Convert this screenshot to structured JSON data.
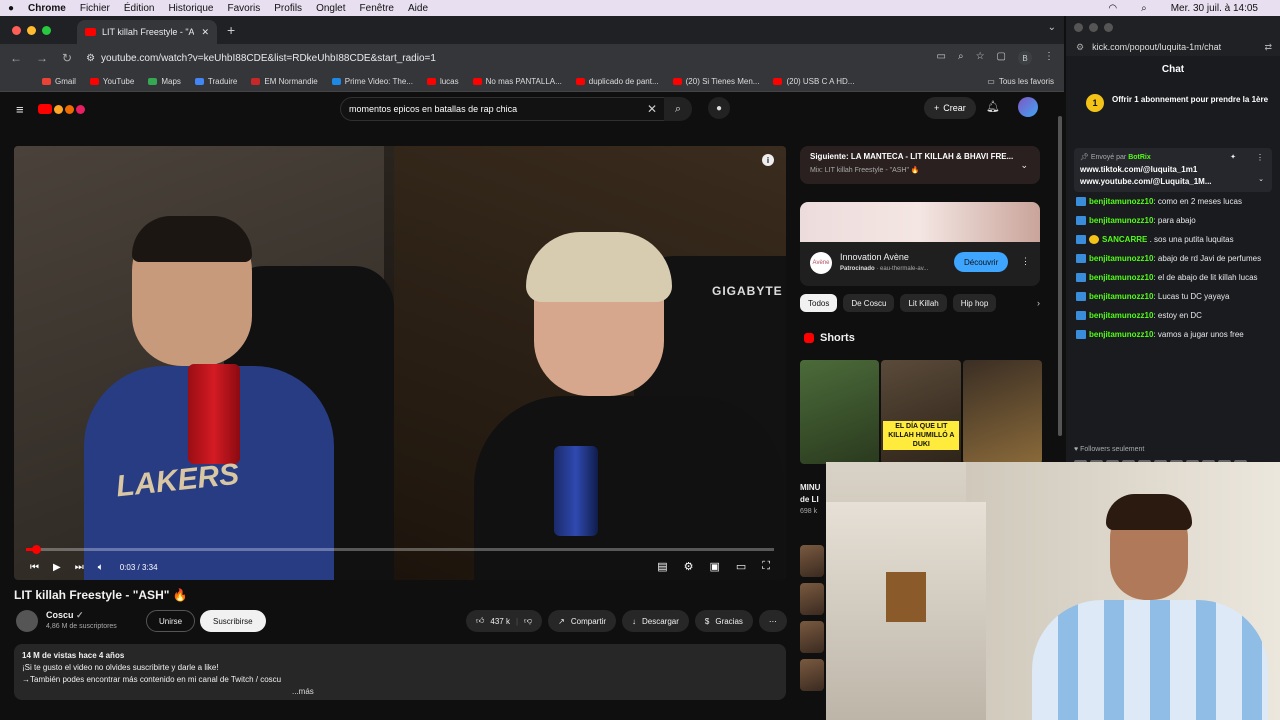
{
  "menubar": {
    "app": "Chrome",
    "items": [
      "Fichier",
      "Édition",
      "Historique",
      "Favoris",
      "Profils",
      "Onglet",
      "Fenêtre",
      "Aide"
    ],
    "clock": "Mer. 30 juil. à 14:05"
  },
  "browser": {
    "tab_title": "LIT killah Freestyle - \"ASH\"",
    "url": "youtube.com/watch?v=keUhbI88CDE&list=RDkeUhbI88CDE&start_radio=1",
    "profile_letter": "B",
    "bookmarks": [
      "Gmail",
      "YouTube",
      "Maps",
      "Traduire",
      "EM Normandie",
      "Prime Video: The...",
      "lucas",
      "No mas PANTALLA...",
      "duplicado de pant...",
      "(20) Si Tienes Men...",
      "(20) USB C A HD..."
    ],
    "bookmarks_all": "Tous les favoris"
  },
  "youtube": {
    "search_value": "momentos epicos en batallas de rap chica",
    "create_label": "Crear",
    "player": {
      "time": "0:03 / 3:34",
      "progress_fraction": 0.014,
      "gigabyte": "GIGABYTE",
      "lakers": "LAKERS"
    },
    "video_title": "LIT killah Freestyle - \"ASH\" 🔥",
    "channel": "Coscu",
    "subscribers": "4,86 M de suscriptores",
    "join_label": "Unirse",
    "subscribe_label": "Suscribirse",
    "likes": "437 k",
    "share_label": "Compartir",
    "download_label": "Descargar",
    "thanks_label": "Gracias",
    "description": {
      "stats": "14 M de vistas  hace 4 años",
      "line1": "¡Si te gusto el video no olvides suscribirte y darle a like!",
      "line2": "→También podes encontrar más contenido en mi canal de Twitch  / coscu",
      "more": "...más"
    },
    "next_up": {
      "title": "Siguiente: LA MANTECA - LIT KILLAH & BHAVI FRE...",
      "sub": "Mix: LIT killah Freestyle - \"ASH\" 🔥"
    },
    "ad": {
      "title": "Innovation Avène",
      "sponsored": "Patrocinado",
      "domain": "· eau-thermale-av...",
      "button": "Découvrir"
    },
    "chips": [
      "Todos",
      "De Coscu",
      "Lit Killah",
      "Hip hop"
    ],
    "shorts_heading": "Shorts",
    "short_caption": "EL DÍA QUE LIT KILLAH HUMILLÓ A DUKI",
    "rest_title": "MINU",
    "rest_title2": "de LI",
    "rest_views": "698 k"
  },
  "kick": {
    "url": "kick.com/popout/luquita-1m/chat",
    "heading": "Chat",
    "gift_text": "Offrir 1 abonnement pour prendre la 1ère",
    "pinned_by": "Envoyé par",
    "pinned_user": "BotRix",
    "pinned_line1": "www.tiktok.com/@luquita_1m1",
    "pinned_line2": "www.youtube.com/@Luquita_1M...",
    "messages": [
      {
        "user": "benjitamunozz10",
        "text": "como en 2 meses lucas"
      },
      {
        "user": "benjitamunozz10",
        "text": "para abajo"
      },
      {
        "user": "SANCARRE",
        "text": ". sos una putita luquitas"
      },
      {
        "user": "benjitamunozz10",
        "text": "abajo de rd Javi de perfumes"
      },
      {
        "user": "benjitamunozz10",
        "text": "el de abajo de lit killah lucas"
      },
      {
        "user": "benjitamunozz10",
        "text": "Lucas tu DC yayaya"
      },
      {
        "user": "benjitamunozz10",
        "text": "estoy en DC"
      },
      {
        "user": "benjitamunozz10",
        "text": "vamos a jugar unos free"
      }
    ],
    "followers_label": "Followers seulement"
  },
  "colors": {
    "yt_red": "#ff0000",
    "kick_green": "#53fc18",
    "link_blue": "#3ea6ff"
  }
}
